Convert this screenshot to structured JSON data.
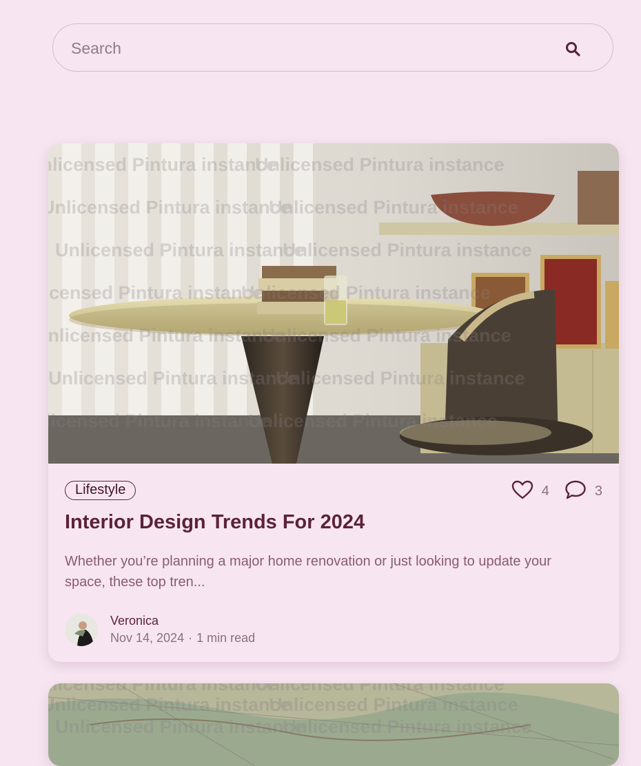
{
  "search": {
    "placeholder": "Search",
    "value": "",
    "icon": "search-icon"
  },
  "posts": [
    {
      "image_watermark": "Unlicensed Pintura instance",
      "category": "Lifestyle",
      "likes": "4",
      "comments": "3",
      "title": "Interior Design Trends For 2024",
      "excerpt": "Whether you’re planning a major home renovation or just looking to update your space, these top tren...",
      "author": "Veronica",
      "date": "Nov 14, 2024",
      "separator": "·",
      "read_time": "1 min read"
    },
    {
      "image_watermark": "Unlicensed Pintura instance"
    }
  ],
  "colors": {
    "background": "#f7e6f2",
    "accent": "#5b2238",
    "muted": "#8a5b72"
  }
}
